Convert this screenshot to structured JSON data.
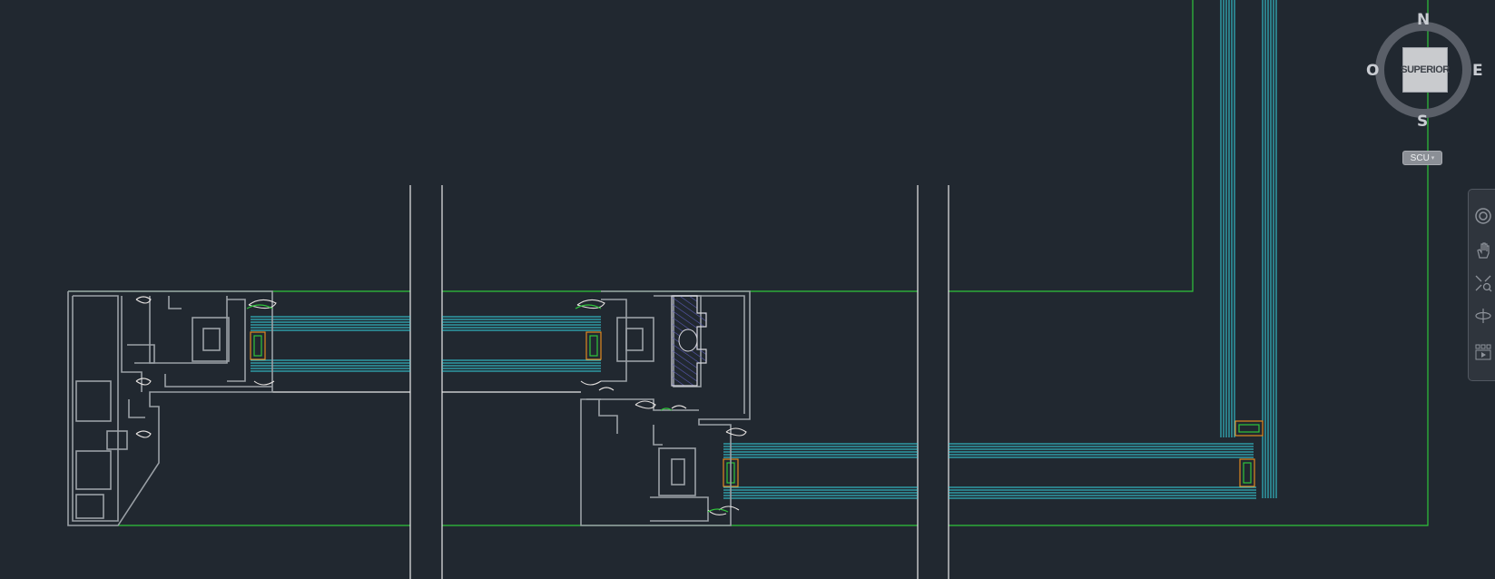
{
  "colors": {
    "background": "#212830",
    "outline_green": "#2fc53a",
    "profile_gray": "#9aa0a6",
    "glass_cyan": "#35d4df",
    "spacer_orange": "#e0891f",
    "gasket_white": "#e6e2e0",
    "hatch_blue": "#5a5ab4"
  },
  "viewcube": {
    "north": "N",
    "south": "S",
    "west": "O",
    "east": "E",
    "face_label": "SUPERIOR",
    "ucs_label": "SCU"
  },
  "navbar": {
    "tools": [
      {
        "icon": "steering-wheel-icon"
      },
      {
        "icon": "pan-icon"
      },
      {
        "icon": "zoom-extents-icon"
      },
      {
        "icon": "orbit-icon"
      },
      {
        "icon": "showmotion-icon"
      }
    ]
  }
}
